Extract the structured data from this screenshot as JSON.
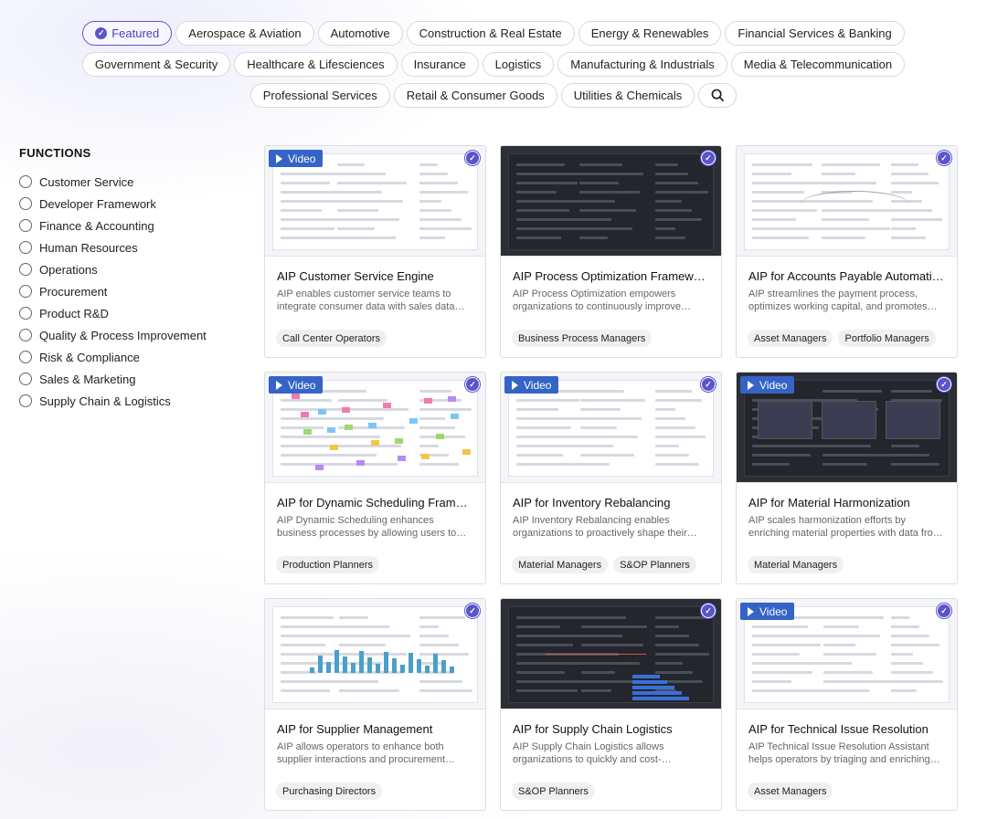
{
  "tags": [
    [
      "Featured",
      "Aerospace & Aviation",
      "Automotive",
      "Construction & Real Estate",
      "Energy & Renewables",
      "Financial Services & Banking"
    ],
    [
      "Government & Security",
      "Healthcare & Lifesciences",
      "Insurance",
      "Logistics",
      "Manufacturing & Industrials",
      "Media & Telecommunication"
    ],
    [
      "Professional Services",
      "Retail & Consumer Goods",
      "Utilities & Chemicals"
    ]
  ],
  "active_tag": "Featured",
  "functions": {
    "heading": "FUNCTIONS",
    "items": [
      "Customer Service",
      "Developer Framework",
      "Finance & Accounting",
      "Human Resources",
      "Operations",
      "Procurement",
      "Product R&D",
      "Quality & Process Improvement",
      "Risk & Compliance",
      "Sales & Marketing",
      "Supply Chain & Logistics"
    ]
  },
  "video_label": "Video",
  "colors": {
    "accent": "#5b55c9",
    "video_badge": "#3564c6"
  },
  "cards": [
    {
      "title": "AIP Customer Service Engine",
      "desc": "AIP enables customer service teams to integrate consumer data with sales data to…",
      "tags": [
        "Call Center Operators"
      ],
      "video": true,
      "theme": "light"
    },
    {
      "title": "AIP Process Optimization Framework",
      "desc": "AIP Process Optimization empowers organizations to continuously improve…",
      "tags": [
        "Business Process Managers"
      ],
      "video": false,
      "theme": "dark"
    },
    {
      "title": "AIP for Accounts Payable Automation",
      "desc": "AIP streamlines the payment process, optimizes working capital, and promotes…",
      "tags": [
        "Asset Managers",
        "Portfolio Managers"
      ],
      "video": false,
      "theme": "light"
    },
    {
      "title": "AIP for Dynamic Scheduling Framew…",
      "desc": "AIP Dynamic Scheduling enhances business processes by allowing users to encode…",
      "tags": [
        "Production Planners"
      ],
      "video": true,
      "theme": "light"
    },
    {
      "title": "AIP for Inventory Rebalancing",
      "desc": "AIP Inventory Rebalancing enables organizations to proactively shape their…",
      "tags": [
        "Material Managers",
        "S&OP Planners"
      ],
      "video": true,
      "theme": "light"
    },
    {
      "title": "AIP for Material Harmonization",
      "desc": "AIP scales harmonization efforts by enriching material properties with data fro…",
      "tags": [
        "Material Managers"
      ],
      "video": true,
      "theme": "dark"
    },
    {
      "title": "AIP for Supplier Management",
      "desc": "AIP allows operators to enhance both supplier interactions and procurement…",
      "tags": [
        "Purchasing Directors"
      ],
      "video": false,
      "theme": "light"
    },
    {
      "title": "AIP for Supply Chain Logistics",
      "desc": "AIP Supply Chain Logistics allows organizations to quickly and cost-effectivel…",
      "tags": [
        "S&OP Planners"
      ],
      "video": false,
      "theme": "dark"
    },
    {
      "title": "AIP for Technical Issue Resolution",
      "desc": "AIP Technical Issue Resolution Assistant helps operators by triaging and enriching…",
      "tags": [
        "Asset Managers"
      ],
      "video": true,
      "theme": "light"
    }
  ]
}
